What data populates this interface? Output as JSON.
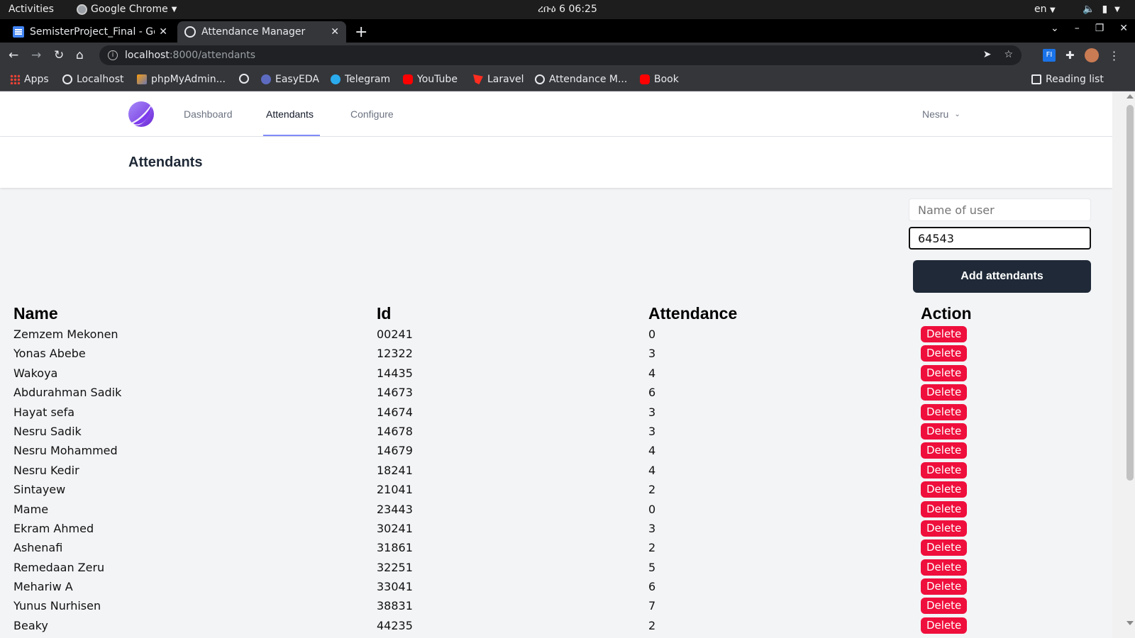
{
  "os": {
    "activities": "Activities",
    "app_name": "Google Chrome",
    "clock": "ረቡዕ 6  06:25",
    "lang": "en"
  },
  "browser": {
    "tabs": [
      {
        "title": "SemisterProject_Final - Go",
        "active": false
      },
      {
        "title": "Attendance Manager",
        "active": true
      }
    ],
    "url_host": "localhost",
    "url_path": ":8000/attendants",
    "bookmarks": [
      {
        "label": "Apps",
        "icon": "apps-icon"
      },
      {
        "label": "Localhost",
        "icon": "globe-icon"
      },
      {
        "label": "phpMyAdmin...",
        "icon": "phpmyadmin-icon"
      },
      {
        "label": "",
        "icon": "globe-icon"
      },
      {
        "label": "EasyEDA",
        "icon": "easyeda-icon"
      },
      {
        "label": "Telegram",
        "icon": "telegram-icon"
      },
      {
        "label": "YouTube",
        "icon": "youtube-icon"
      },
      {
        "label": "Laravel",
        "icon": "laravel-icon"
      },
      {
        "label": "Attendance M...",
        "icon": "globe-icon"
      },
      {
        "label": "Book",
        "icon": "youtube-icon"
      }
    ],
    "reading_list": "Reading list"
  },
  "app": {
    "nav": [
      {
        "label": "Dashboard"
      },
      {
        "label": "Attendants"
      },
      {
        "label": "Configure"
      }
    ],
    "active_nav": "Attendants",
    "user": "Nesru",
    "page_title": "Attendants",
    "form": {
      "name_placeholder": "Name of user",
      "id_value": "64543",
      "submit_label": "Add attendants"
    },
    "table": {
      "headers": {
        "name": "Name",
        "id": "Id",
        "attendance": "Attendance",
        "action": "Action"
      },
      "delete_label": "Delete",
      "rows": [
        {
          "name": "Zemzem Mekonen",
          "id": "00241",
          "attendance": "0"
        },
        {
          "name": "Yonas Abebe",
          "id": "12322",
          "attendance": "3"
        },
        {
          "name": "Wakoya",
          "id": "14435",
          "attendance": "4"
        },
        {
          "name": "Abdurahman Sadik",
          "id": "14673",
          "attendance": "6"
        },
        {
          "name": "Hayat sefa",
          "id": "14674",
          "attendance": "3"
        },
        {
          "name": "Nesru Sadik",
          "id": "14678",
          "attendance": "3"
        },
        {
          "name": "Nesru Mohammed",
          "id": "14679",
          "attendance": "4"
        },
        {
          "name": "Nesru Kedir",
          "id": "18241",
          "attendance": "4"
        },
        {
          "name": "Sintayew",
          "id": "21041",
          "attendance": "2"
        },
        {
          "name": "Mame",
          "id": "23443",
          "attendance": "0"
        },
        {
          "name": "Ekram Ahmed",
          "id": "30241",
          "attendance": "3"
        },
        {
          "name": "Ashenafi",
          "id": "31861",
          "attendance": "2"
        },
        {
          "name": "Remedaan Zeru",
          "id": "32251",
          "attendance": "5"
        },
        {
          "name": "Mehariw A",
          "id": "33041",
          "attendance": "6"
        },
        {
          "name": "Yunus Nurhisen",
          "id": "38831",
          "attendance": "7"
        },
        {
          "name": "Beaky",
          "id": "44235",
          "attendance": "2"
        }
      ]
    }
  },
  "colors": {
    "delete_button": "#ef0f3c",
    "primary_button": "#1f2937",
    "accent": "#818cf8"
  }
}
